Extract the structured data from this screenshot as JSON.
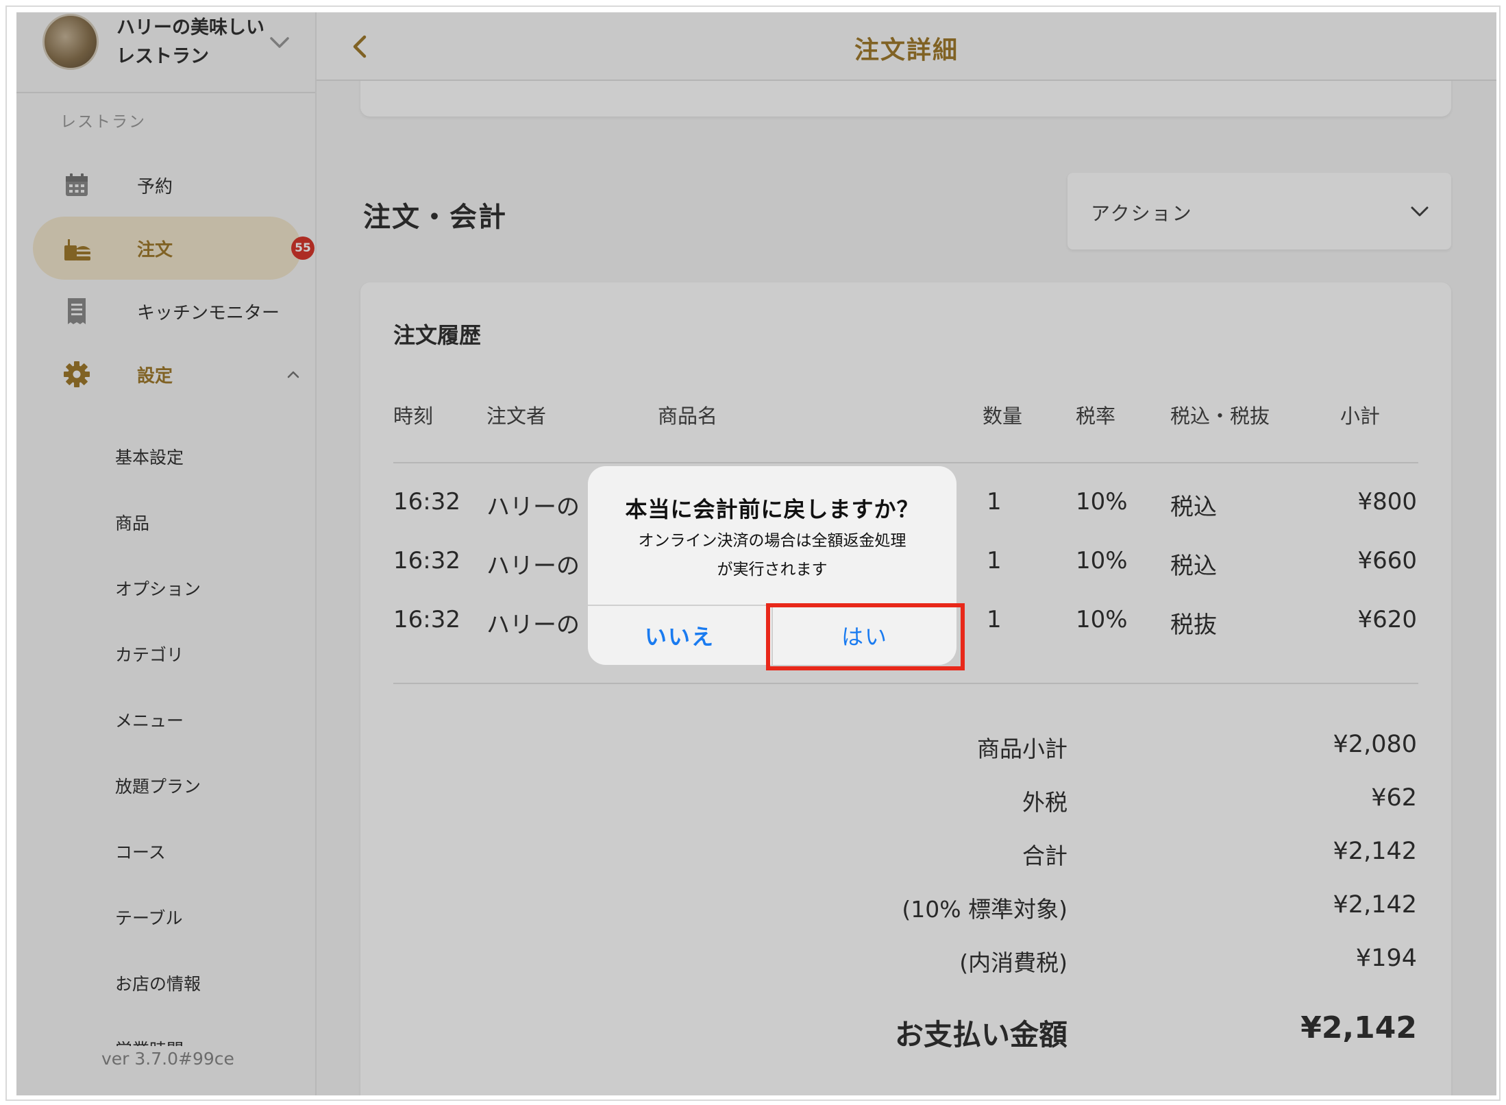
{
  "restaurant": {
    "name_line1": "ハリーの美味しい",
    "name_line2": "レストラン"
  },
  "sidebar": {
    "section_label": "レストラン",
    "items": [
      {
        "label": "予約",
        "icon": "calendar-icon"
      },
      {
        "label": "注文",
        "icon": "food-bag-icon",
        "badge": "55",
        "active": true
      },
      {
        "label": "キッチンモニター",
        "icon": "receipt-icon"
      },
      {
        "label": "設定",
        "icon": "gear-icon",
        "expanded": true
      }
    ],
    "sub_items": [
      "基本設定",
      "商品",
      "オプション",
      "カテゴリ",
      "メニュー",
      "放題プラン",
      "コース",
      "テーブル",
      "お店の情報",
      "営業時間"
    ],
    "version": "ver 3.7.0#99ce"
  },
  "header": {
    "title": "注文詳細"
  },
  "section": {
    "title": "注文・会計",
    "action_label": "アクション"
  },
  "order_history": {
    "title": "注文履歴",
    "columns": [
      "時刻",
      "注文者",
      "商品名",
      "数量",
      "税率",
      "税込・税抜",
      "小計"
    ],
    "rows": [
      {
        "time": "16:32",
        "customer": "ハリーの",
        "qty": "1",
        "rate": "10%",
        "tax": "税込",
        "subtotal": "¥800"
      },
      {
        "time": "16:32",
        "customer": "ハリーの",
        "qty": "1",
        "rate": "10%",
        "tax": "税込",
        "subtotal": "¥660"
      },
      {
        "time": "16:32",
        "customer": "ハリーの",
        "qty": "1",
        "rate": "10%",
        "tax": "税抜",
        "subtotal": "¥620"
      }
    ]
  },
  "summary": [
    {
      "label": "商品小計",
      "value": "¥2,080"
    },
    {
      "label": "外税",
      "value": "¥62"
    },
    {
      "label": "合計",
      "value": "¥2,142"
    },
    {
      "label": "(10% 標準対象)",
      "value": "¥2,142"
    },
    {
      "label": "(内消費税)",
      "value": "¥194"
    }
  ],
  "payment": {
    "label": "お支払い金額",
    "value": "¥2,142"
  },
  "dialog": {
    "title": "本当に会計前に戻しますか？",
    "message_line1": "オンライン決済の場合は全額返金処理",
    "message_line2": "が実行されます",
    "no_label": "いいえ",
    "yes_label": "はい"
  },
  "colors": {
    "accent": "#a17b2e",
    "active_bg": "#f2e6cd",
    "badge": "#d9382c",
    "link_blue": "#1a7bf0",
    "highlight": "#e8281a"
  }
}
